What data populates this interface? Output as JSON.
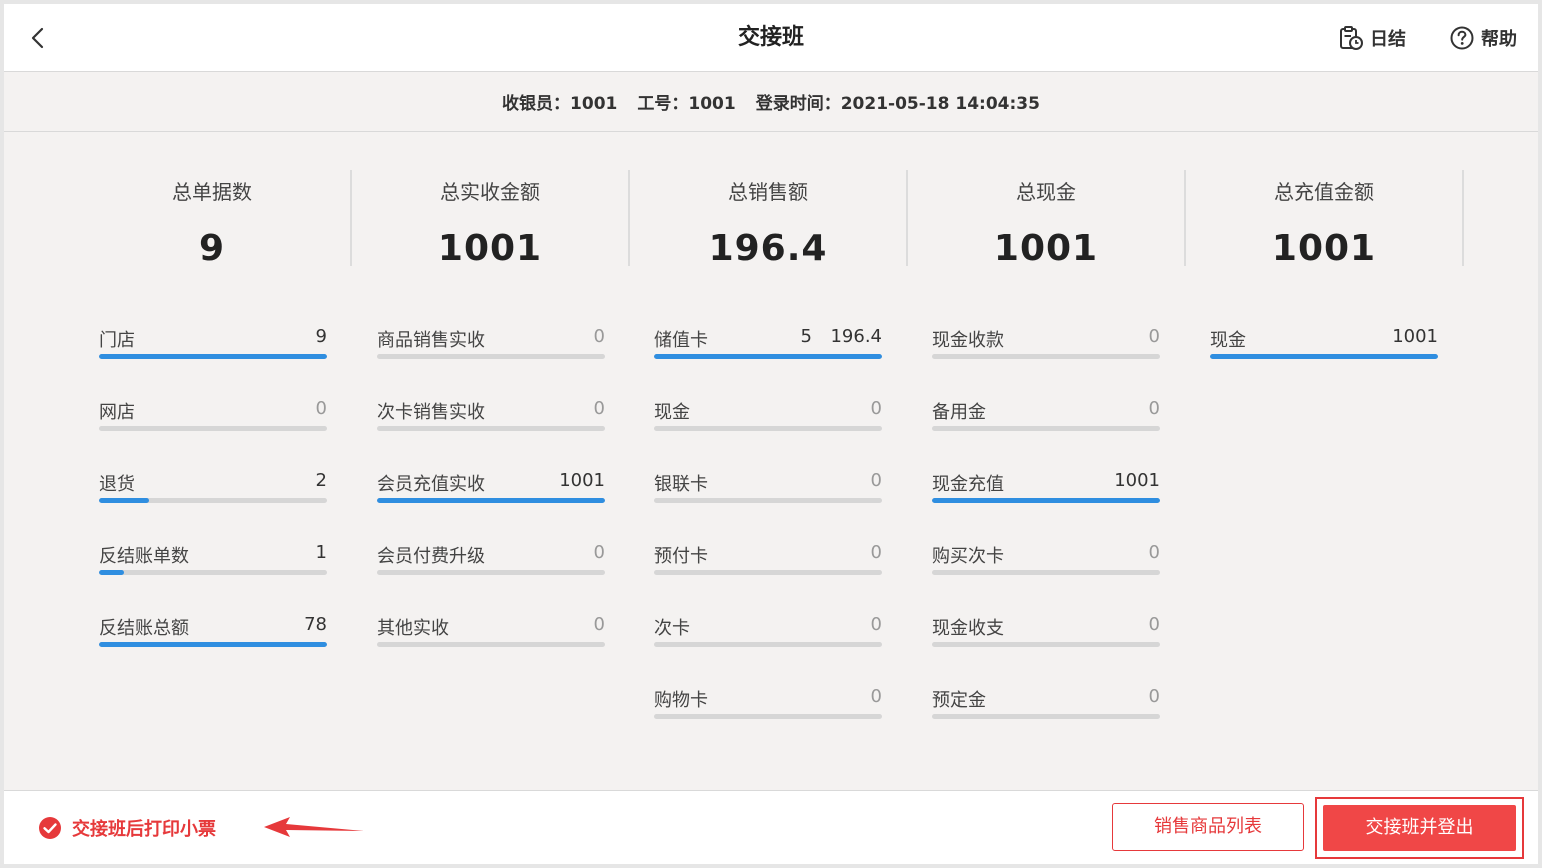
{
  "header": {
    "title": "交接班",
    "daily_label": "日结",
    "help_label": "帮助"
  },
  "info": {
    "cashier": "收银员：1001",
    "employee_no": "工号：1001",
    "login_time": "登录时间：2021-05-18 14:04:35"
  },
  "summary": [
    {
      "label": "总单据数",
      "value": "9"
    },
    {
      "label": "总实收金额",
      "value": "1001"
    },
    {
      "label": "总销售额",
      "value": "196.4"
    },
    {
      "label": "总现金",
      "value": "1001"
    },
    {
      "label": "总充值金额",
      "value": "1001"
    }
  ],
  "columns": [
    [
      {
        "label": "门店",
        "value": "9",
        "fill": 1.0
      },
      {
        "label": "网店",
        "value": "0",
        "fill": 0
      },
      {
        "label": "退货",
        "value": "2",
        "fill": 0.22
      },
      {
        "label": "反结账单数",
        "value": "1",
        "fill": 0.11
      },
      {
        "label": "反结账总额",
        "value": "78",
        "fill": 1.0
      }
    ],
    [
      {
        "label": "商品销售实收",
        "value": "0",
        "fill": 0
      },
      {
        "label": "次卡销售实收",
        "value": "0",
        "fill": 0
      },
      {
        "label": "会员充值实收",
        "value": "1001",
        "fill": 1.0
      },
      {
        "label": "会员付费升级",
        "value": "0",
        "fill": 0
      },
      {
        "label": "其他实收",
        "value": "0",
        "fill": 0
      }
    ],
    [
      {
        "label": "储值卡",
        "count": "5",
        "value": "196.4",
        "fill": 1.0
      },
      {
        "label": "现金",
        "value": "0",
        "fill": 0
      },
      {
        "label": "银联卡",
        "value": "0",
        "fill": 0
      },
      {
        "label": "预付卡",
        "value": "0",
        "fill": 0
      },
      {
        "label": "次卡",
        "value": "0",
        "fill": 0
      },
      {
        "label": "购物卡",
        "value": "0",
        "fill": 0
      }
    ],
    [
      {
        "label": "现金收款",
        "value": "0",
        "fill": 0
      },
      {
        "label": "备用金",
        "value": "0",
        "fill": 0
      },
      {
        "label": "现金充值",
        "value": "1001",
        "fill": 1.0
      },
      {
        "label": "购买次卡",
        "value": "0",
        "fill": 0
      },
      {
        "label": "现金收支",
        "value": "0",
        "fill": 0
      },
      {
        "label": "预定金",
        "value": "0",
        "fill": 0
      }
    ],
    [
      {
        "label": "现金",
        "value": "1001",
        "fill": 1.0
      }
    ]
  ],
  "footer": {
    "print_label": "交接班后打印小票",
    "print_checked": true,
    "list_button": "销售商品列表",
    "logout_button": "交接班并登出"
  },
  "colors": {
    "accent_blue": "#2f8ee0",
    "danger_red": "#e6393b",
    "track_gray": "#d6d6d6"
  }
}
